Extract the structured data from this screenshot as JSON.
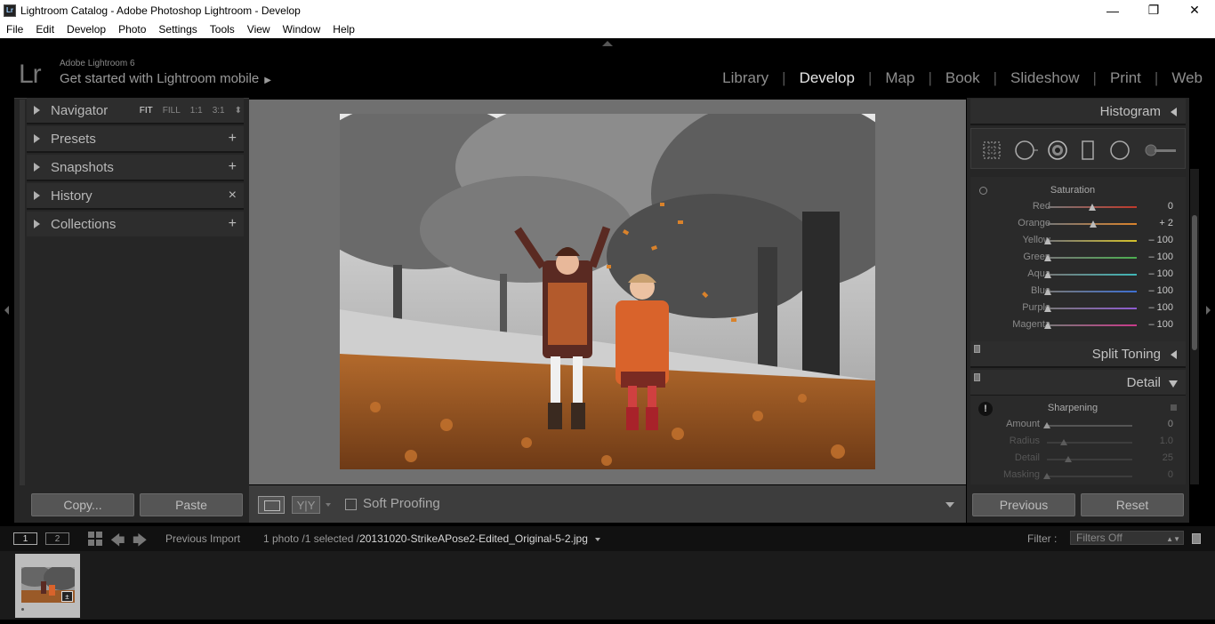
{
  "window": {
    "app_icon": "Lr",
    "title": "Lightroom Catalog - Adobe Photoshop Lightroom - Develop",
    "minimize": "—",
    "maximize": "❐",
    "close": "✕"
  },
  "menu": [
    "File",
    "Edit",
    "Develop",
    "Photo",
    "Settings",
    "Tools",
    "View",
    "Window",
    "Help"
  ],
  "identity": {
    "logo": "Lr",
    "product": "Adobe Lightroom 6",
    "cta": "Get started with Lightroom mobile",
    "cta_arrow": "▶"
  },
  "modules": {
    "items": [
      "Library",
      "Develop",
      "Map",
      "Book",
      "Slideshow",
      "Print",
      "Web"
    ],
    "active": "Develop",
    "separator": "|"
  },
  "left_panel": {
    "navigator": {
      "label": "Navigator",
      "options": [
        "FIT",
        "FILL",
        "1:1",
        "3:1"
      ],
      "selected": "FIT",
      "more": "⬍"
    },
    "presets": {
      "label": "Presets",
      "action": "+"
    },
    "snapshots": {
      "label": "Snapshots",
      "action": "+"
    },
    "history": {
      "label": "History",
      "action": "×"
    },
    "collections": {
      "label": "Collections",
      "action": "+"
    },
    "copy_button": "Copy...",
    "paste_button": "Paste"
  },
  "toolbar": {
    "compare_label": "Y|Y",
    "soft_proofing_label": "Soft Proofing",
    "soft_proofing_checked": false
  },
  "right_panel": {
    "histogram_label": "Histogram",
    "tools": [
      "crop-overlay-icon",
      "spot-removal-icon",
      "red-eye-icon",
      "graduated-filter-icon",
      "radial-filter-icon",
      "adjustment-brush-icon"
    ],
    "hsl": {
      "title": "Saturation",
      "rows": [
        {
          "label": "Red",
          "value": "0",
          "slider": 0,
          "color": "#c0392b"
        },
        {
          "label": "Orange",
          "value": "+ 2",
          "slider": 2,
          "color": "#d9822b"
        },
        {
          "label": "Yellow",
          "value": "– 100",
          "slider": -100,
          "color": "#d4c12b"
        },
        {
          "label": "Green",
          "value": "– 100",
          "slider": -100,
          "color": "#4caf50"
        },
        {
          "label": "Aqua",
          "value": "– 100",
          "slider": -100,
          "color": "#3fb7b7"
        },
        {
          "label": "Blue",
          "value": "– 100",
          "slider": -100,
          "color": "#3d6fd1"
        },
        {
          "label": "Purple",
          "value": "– 100",
          "slider": -100,
          "color": "#8e5bd1"
        },
        {
          "label": "Magenta",
          "value": "– 100",
          "slider": -100,
          "color": "#c93a8a"
        }
      ]
    },
    "split_toning_label": "Split Toning",
    "detail": {
      "label": "Detail",
      "sharpening_title": "Sharpening",
      "warning": "!",
      "rows": [
        {
          "label": "Amount",
          "value": "0",
          "slider": 0
        },
        {
          "label": "Radius",
          "value": "1.0",
          "slider": 0.2
        },
        {
          "label": "Detail",
          "value": "25",
          "slider": 0.25
        },
        {
          "label": "Masking",
          "value": "0",
          "slider": 0
        }
      ]
    },
    "previous_button": "Previous",
    "reset_button": "Reset"
  },
  "filmstrip": {
    "screen1": "1",
    "screen2": "2",
    "source": "Previous Import",
    "count": "1 photo /1 selected /",
    "filename": "20131020-StrikeAPose2-Edited_Original-5-2.jpg",
    "filter_label": "Filter :",
    "filter_value": "Filters Off",
    "prev_arrow": "🡄",
    "next_arrow": "🡆"
  },
  "colors": {
    "background": "#000000",
    "panel": "#262626",
    "canvas": "#707070",
    "active_module": "#e6e6e6"
  }
}
